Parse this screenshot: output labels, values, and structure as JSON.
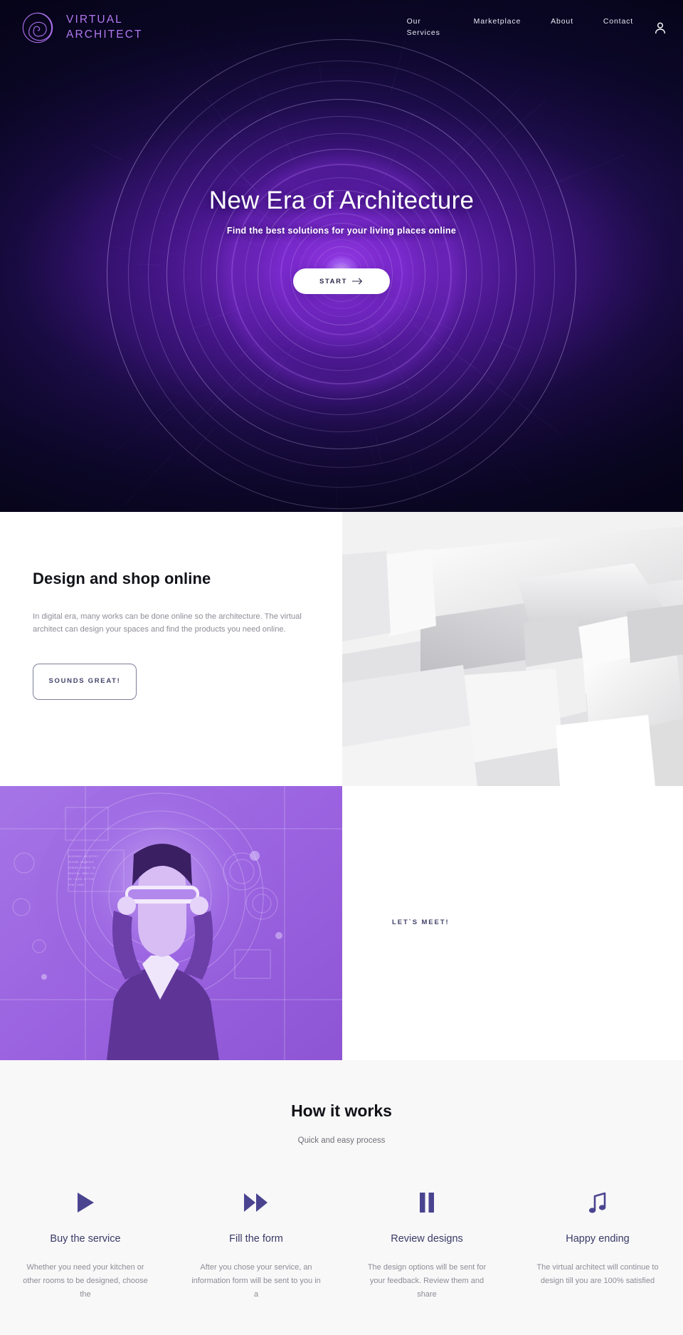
{
  "brand": {
    "name_line1": "VIRTUAL",
    "name_line2": "ARCHITECT",
    "logo_icon": "spiral-icon",
    "color": "#b278f0"
  },
  "nav": {
    "items": [
      {
        "label": "Our Services",
        "name": "our-services"
      },
      {
        "label": "Marketplace",
        "name": "marketplace"
      },
      {
        "label": "About",
        "name": "about"
      },
      {
        "label": "Contact",
        "name": "contact"
      }
    ],
    "account_icon": "user-icon"
  },
  "hero": {
    "title": "New Era of Architecture",
    "subtitle": "Find the best solutions for your living places online",
    "cta_label": "START",
    "cta_icon": "arrow-right-icon",
    "background_color": "#0a0824",
    "accent_color": "#8a2be2"
  },
  "design_section": {
    "heading": "Design and shop online",
    "body": "In digital era, many works can be done online so the architecture. The virtual architect can design your spaces and find the products you need online.",
    "button_label": "SOUNDS GREAT!",
    "image_alt": "white-abstract-architecture"
  },
  "meet_section": {
    "label": "LET`S MEET!",
    "image_alt": "woman-wearing-vr-headset"
  },
  "how_it_works": {
    "heading": "How it works",
    "subheading": "Quick and easy process",
    "steps": [
      {
        "icon": "play-icon",
        "title": "Buy the service",
        "text": "Whether you need your kitchen or other rooms to be designed, choose the"
      },
      {
        "icon": "fast-forward-icon",
        "title": "Fill the form",
        "text": "After you chose your service, an information form will be sent to you in a"
      },
      {
        "icon": "pause-icon",
        "title": "Review designs",
        "text": "The design options will be sent for your feedback. Review them and share"
      },
      {
        "icon": "music-note-icon",
        "title": "Happy ending",
        "text": "The virtual architect will continue to design till you are 100% satisfied"
      }
    ]
  }
}
